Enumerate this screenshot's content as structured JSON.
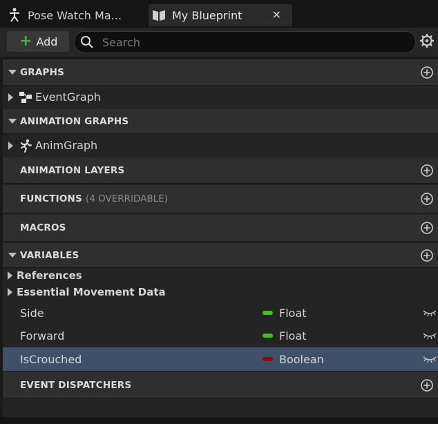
{
  "tabs": [
    {
      "label": "Pose Watch Ma...",
      "icon": "skeleton-icon"
    },
    {
      "label": "My Blueprint",
      "icon": "book-icon",
      "close": "✕"
    }
  ],
  "toolbar": {
    "add_label": "Add",
    "search_placeholder": "Search",
    "settings_icon": "gear-icon"
  },
  "sections": {
    "graphs": {
      "label": "GRAPHS",
      "items": [
        {
          "label": "EventGraph",
          "icon": "graph-nodes-icon"
        }
      ]
    },
    "animation_graphs": {
      "label": "ANIMATION GRAPHS",
      "items": [
        {
          "label": "AnimGraph",
          "icon": "running-figure-icon"
        }
      ]
    },
    "animation_layers": {
      "label": "ANIMATION LAYERS"
    },
    "functions": {
      "label": "FUNCTIONS",
      "sub": "(4 OVERRIDABLE)"
    },
    "macros": {
      "label": "MACROS"
    },
    "variables": {
      "label": "VARIABLES",
      "categories": [
        "References",
        "Essential Movement Data"
      ],
      "items": [
        {
          "name": "Side",
          "type": "Float",
          "color": "#3ec21a"
        },
        {
          "name": "Forward",
          "type": "Float",
          "color": "#3ec21a"
        },
        {
          "name": "IsCrouched",
          "type": "Boolean",
          "color": "#8b0a0a",
          "selected": true
        }
      ]
    },
    "event_dispatchers": {
      "label": "EVENT DISPATCHERS"
    }
  },
  "colors": {
    "accent_add": "#4caf3a",
    "selection": "#3e5168",
    "float_pin": "#3ec21a",
    "boolean_pin": "#8b0a0a"
  }
}
